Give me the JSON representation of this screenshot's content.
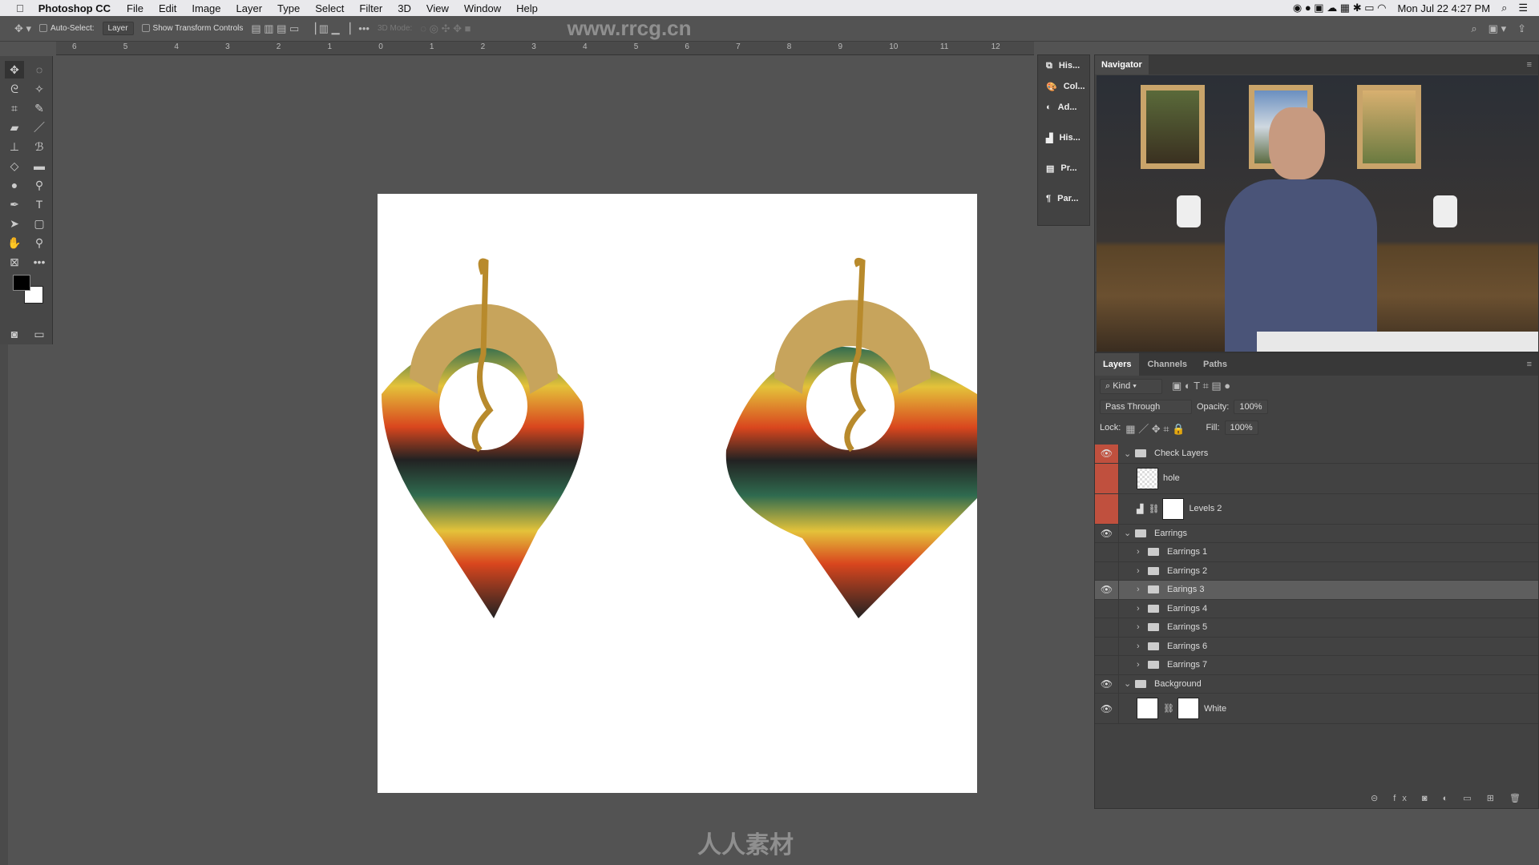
{
  "menubar": {
    "app": "Photoshop CC",
    "items": [
      "File",
      "Edit",
      "Image",
      "Layer",
      "Type",
      "Select",
      "Filter",
      "3D",
      "View",
      "Window",
      "Help"
    ],
    "clock": "Mon Jul 22  4:27 PM"
  },
  "options": {
    "auto_select": "Auto-Select:",
    "auto_select_target": "Layer",
    "show_transform": "Show Transform Controls",
    "mode_3d": "3D Mode:"
  },
  "ruler": {
    "ticks": [
      "6",
      "5",
      "4",
      "3",
      "2",
      "1",
      "0",
      "1",
      "2",
      "3",
      "4",
      "5",
      "6",
      "7",
      "8",
      "9",
      "10",
      "11",
      "12"
    ]
  },
  "collapsed_panels": [
    {
      "label": "His...",
      "icon": "history-icon"
    },
    {
      "label": "Col...",
      "icon": "color-palette-icon"
    },
    {
      "label": "Ad...",
      "icon": "adjustments-icon"
    },
    {
      "label": "His...",
      "icon": "histogram-icon"
    },
    {
      "label": "Pr...",
      "icon": "properties-icon"
    },
    {
      "label": "Par...",
      "icon": "paragraph-icon"
    }
  ],
  "navigator": {
    "title": "Navigator"
  },
  "layers_panel": {
    "tabs": [
      "Layers",
      "Channels",
      "Paths"
    ],
    "filter": "Kind",
    "blend_mode": "Pass Through",
    "opacity_label": "Opacity:",
    "opacity": "100%",
    "lock_label": "Lock:",
    "fill_label": "Fill:",
    "fill": "100%",
    "layers": [
      {
        "name": "Check Layers",
        "type": "group",
        "visible": true,
        "expanded": true,
        "indent": 0,
        "tag": "red"
      },
      {
        "name": "hole",
        "type": "pixel",
        "visible": false,
        "indent": 1,
        "tag": "red"
      },
      {
        "name": "Levels 2",
        "type": "adjustment",
        "visible": false,
        "indent": 1,
        "tag": "red"
      },
      {
        "name": "Earrings",
        "type": "group",
        "visible": true,
        "expanded": true,
        "indent": 0
      },
      {
        "name": "Earrings 1",
        "type": "group",
        "visible": false,
        "indent": 1
      },
      {
        "name": "Earrings 2",
        "type": "group",
        "visible": false,
        "indent": 1
      },
      {
        "name": "Earings 3",
        "type": "group",
        "visible": true,
        "indent": 1,
        "selected": true
      },
      {
        "name": "Earrings 4",
        "type": "group",
        "visible": false,
        "indent": 1
      },
      {
        "name": "Earrings 5",
        "type": "group",
        "visible": false,
        "indent": 1
      },
      {
        "name": "Earrings 6",
        "type": "group",
        "visible": false,
        "indent": 1
      },
      {
        "name": "Earrings 7",
        "type": "group",
        "visible": false,
        "indent": 1
      },
      {
        "name": "Background",
        "type": "group",
        "visible": true,
        "expanded": true,
        "indent": 0
      },
      {
        "name": "White",
        "type": "fill",
        "visible": true,
        "indent": 1
      }
    ]
  },
  "watermarks": {
    "top": "www.rrcg.cn",
    "bottom": "人人素材"
  },
  "colors": {
    "tag_red": "#c0503e",
    "ui_bg": "#535353",
    "panel_bg": "#424242"
  }
}
